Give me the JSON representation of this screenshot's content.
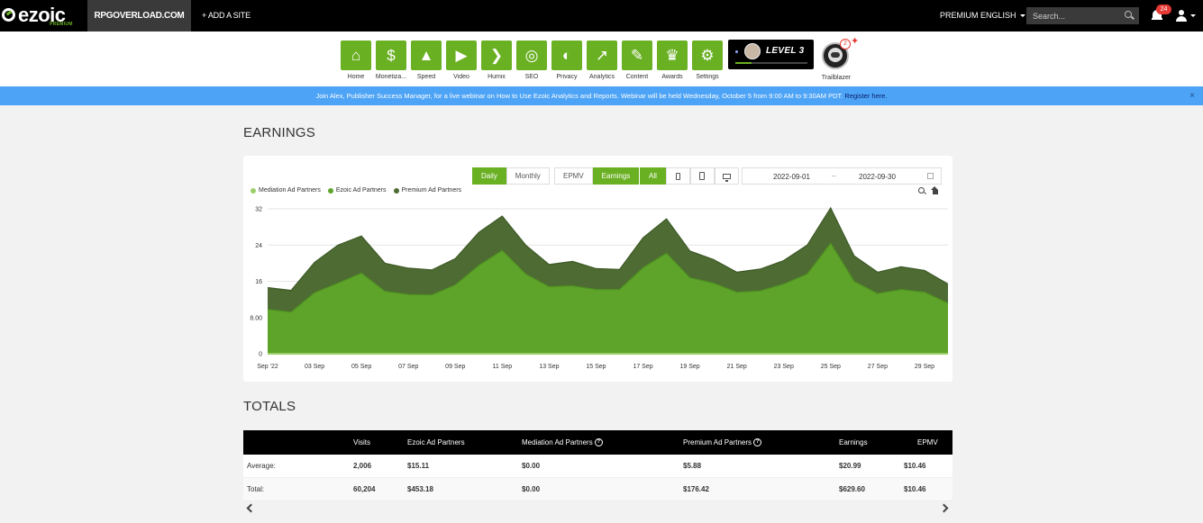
{
  "brand": {
    "name": "ezoic",
    "tier": "PREMIUM"
  },
  "topbar": {
    "site": "RPGOVERLOAD.COM",
    "add_site": "+ ADD A SITE",
    "premium": "PREMIUM",
    "language": "ENGLISH",
    "search_placeholder": "Search...",
    "notifications": "24"
  },
  "tools": [
    {
      "label": "Home",
      "icon": "home-icon",
      "glyph": "⌂"
    },
    {
      "label": "Monetiza...",
      "icon": "dollar-icon",
      "glyph": "$"
    },
    {
      "label": "Speed",
      "icon": "rocket-icon",
      "glyph": "▲"
    },
    {
      "label": "Video",
      "icon": "video-icon",
      "glyph": "▶"
    },
    {
      "label": "Humix",
      "icon": "chevron-right-icon",
      "glyph": "❯"
    },
    {
      "label": "SEO",
      "icon": "magnifier-icon",
      "glyph": "◎"
    },
    {
      "label": "Privacy",
      "icon": "shield-icon",
      "glyph": "◐"
    },
    {
      "label": "Analytics",
      "icon": "line-chart-icon",
      "glyph": "↗"
    },
    {
      "label": "Content",
      "icon": "document-icon",
      "glyph": "✎"
    },
    {
      "label": "Awards",
      "icon": "trophy-icon",
      "glyph": "♛"
    },
    {
      "label": "Settings",
      "icon": "gear-icon",
      "glyph": "⚙"
    }
  ],
  "level": {
    "text": "LEVEL 3",
    "progress": 0.22
  },
  "trailblazer": {
    "label": "Trailblazer",
    "count": "2"
  },
  "banner": {
    "text": "Join Alex, Publisher Success Manager, for a live webinar on How to Use Ezoic Analytics and Reports. Webinar will be held Wednesday, October 5 from 9:00 AM to 9:30AM PDT.",
    "link": "Register here.",
    "close": "×"
  },
  "earnings": {
    "title": "EARNINGS",
    "period": {
      "daily": "Daily",
      "monthly": "Monthly"
    },
    "metric": {
      "epmv": "EPMV",
      "earnings": "Earnings"
    },
    "device_all": "All",
    "date_start": "2022-09-01",
    "date_sep": "–",
    "date_end": "2022-09-30"
  },
  "chart_data": {
    "type": "area",
    "stacked": true,
    "x_labels": [
      "Sep '22",
      "03 Sep",
      "05 Sep",
      "07 Sep",
      "09 Sep",
      "11 Sep",
      "13 Sep",
      "15 Sep",
      "17 Sep",
      "19 Sep",
      "21 Sep",
      "23 Sep",
      "25 Sep",
      "27 Sep",
      "29 Sep"
    ],
    "x": [
      1,
      2,
      3,
      4,
      5,
      6,
      7,
      8,
      9,
      10,
      11,
      12,
      13,
      14,
      15,
      16,
      17,
      18,
      19,
      20,
      21,
      22,
      23,
      24,
      25,
      26,
      27,
      28,
      29,
      30
    ],
    "y_ticks": [
      "0",
      "8.00",
      "16",
      "24",
      "32"
    ],
    "ylim": [
      0,
      32
    ],
    "grid": true,
    "legend_position": "top-left",
    "series": [
      {
        "name": "Mediation Ad Partners",
        "color": "#9ccf6a",
        "values": [
          0,
          0,
          0,
          0,
          0,
          0,
          0,
          0,
          0,
          0,
          0,
          0,
          0,
          0,
          0,
          0,
          0,
          0,
          0,
          0,
          0,
          0,
          0,
          0,
          0,
          0,
          0,
          0,
          0,
          0
        ]
      },
      {
        "name": "Ezoic Ad Partners",
        "color": "#5ea32a",
        "values": [
          9.8,
          9.2,
          13.5,
          15.6,
          17.8,
          13.8,
          13.1,
          13.0,
          15.2,
          19.5,
          22.8,
          17.6,
          14.8,
          15.0,
          14.2,
          14.2,
          19.0,
          22.2,
          16.8,
          15.6,
          13.6,
          13.9,
          15.4,
          17.6,
          24.4,
          16.0,
          13.3,
          14.2,
          13.6,
          11.2
        ]
      },
      {
        "name": "Premium Ad Partners",
        "color": "#4d6b32",
        "values": [
          4.8,
          4.8,
          6.7,
          8.4,
          8.2,
          6.2,
          5.8,
          5.5,
          5.8,
          7.3,
          7.6,
          6.4,
          4.9,
          5.4,
          4.6,
          4.4,
          6.6,
          7.6,
          5.9,
          5.2,
          4.4,
          4.8,
          5.2,
          6.4,
          7.8,
          5.6,
          4.7,
          5.0,
          4.8,
          4.2
        ]
      }
    ]
  },
  "totals": {
    "title": "TOTALS",
    "columns": [
      "",
      "Visits",
      "Ezoic Ad Partners",
      "Mediation Ad Partners",
      "Premium Ad Partners",
      "Earnings",
      "EPMV"
    ],
    "help": "?",
    "rows": [
      {
        "label": "Average:",
        "visits": "2,006",
        "ezoic": "$15.11",
        "mediation": "$0.00",
        "premium": "$5.88",
        "earnings": "$20.99",
        "epmv": "$10.46"
      },
      {
        "label": "Total:",
        "visits": "60,204",
        "ezoic": "$453.18",
        "mediation": "$0.00",
        "premium": "$176.42",
        "earnings": "$629.60",
        "epmv": "$10.46"
      }
    ]
  },
  "colors": {
    "brand_green": "#6ab023",
    "banner_blue": "#4da3f5",
    "topbar": "#000000"
  }
}
